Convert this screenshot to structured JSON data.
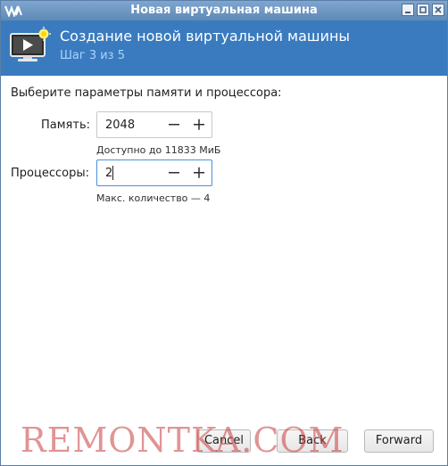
{
  "window": {
    "title": "Новая виртуальная машина"
  },
  "header": {
    "title": "Создание новой виртуальной машины",
    "step": "Шаг 3 из 5"
  },
  "content": {
    "prompt": "Выберите параметры памяти и процессора:",
    "memory": {
      "label": "Память:",
      "value": "2048",
      "hint": "Доступно до 11833 МиБ"
    },
    "cpus": {
      "label": "Процессоры:",
      "value": "2",
      "hint": "Макс. количество — 4"
    }
  },
  "buttons": {
    "cancel": "Cancel",
    "back": "Back",
    "forward": "Forward"
  },
  "watermark": "REMONTKA.COM",
  "colors": {
    "banner": "#3a7bbf",
    "titlebar": "#6e98c4",
    "focus": "#4a90d9",
    "watermark": "#c83c3c"
  }
}
